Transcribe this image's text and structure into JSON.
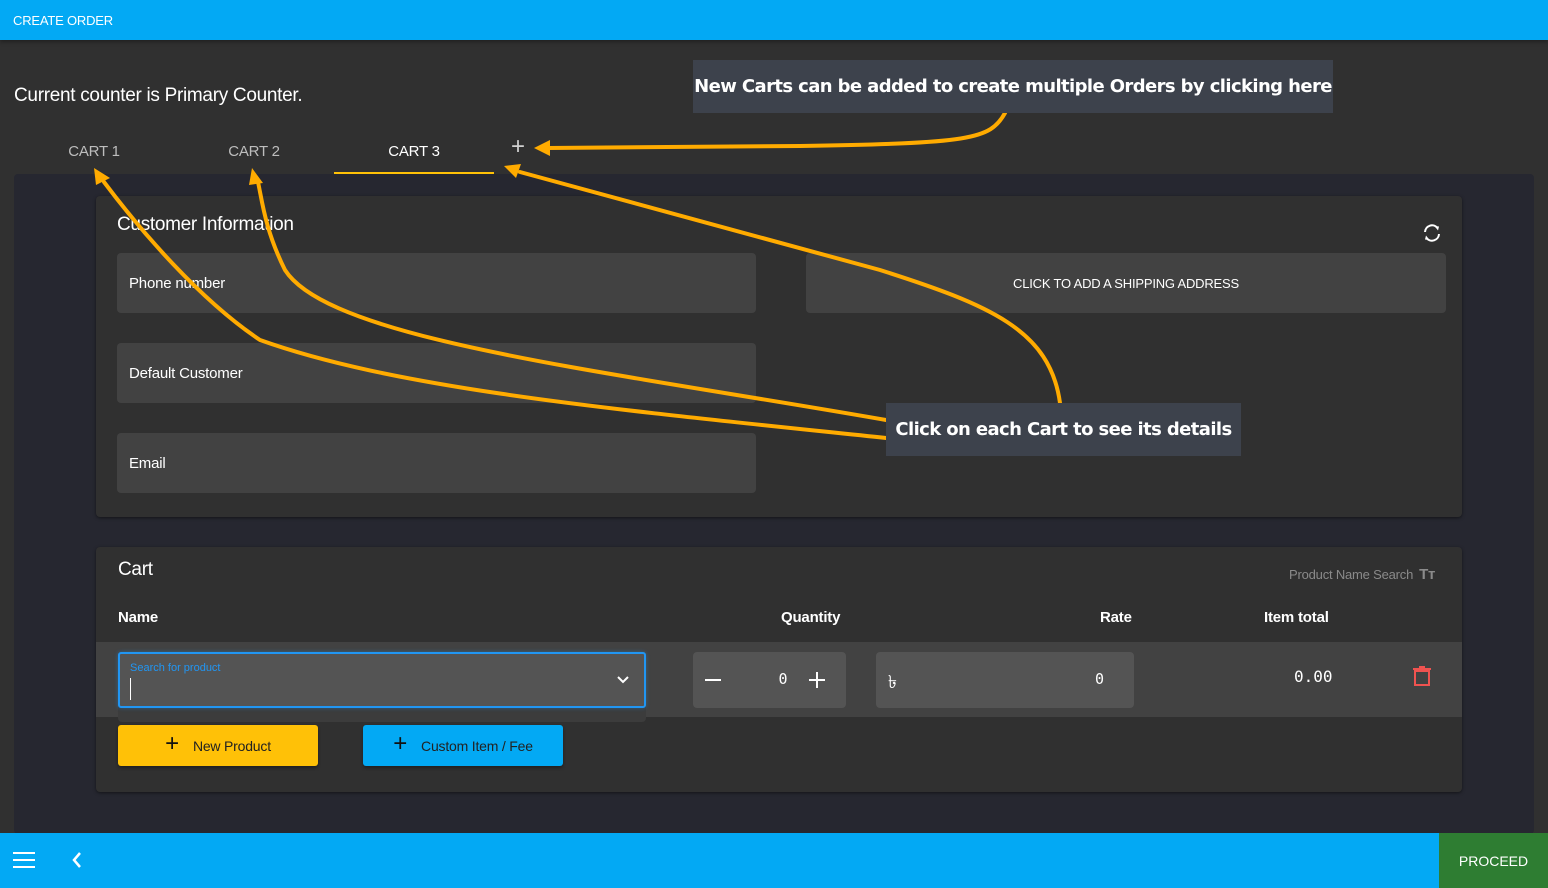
{
  "header": {
    "title": "CREATE ORDER"
  },
  "counter_text": "Current counter is Primary Counter.",
  "tabs": [
    {
      "label": "CART 1",
      "active": false
    },
    {
      "label": "CART 2",
      "active": false
    },
    {
      "label": "CART 3",
      "active": true
    }
  ],
  "add_tab_icon": "plus-icon",
  "customer_info": {
    "title": "Customer Information",
    "refresh_icon": "refresh-icon",
    "phone_placeholder": "Phone number",
    "name_value": "Default Customer",
    "email_placeholder": "Email",
    "shipping_button": "CLICK TO ADD A SHIPPING ADDRESS"
  },
  "cart": {
    "title": "Cart",
    "product_name_search": "Product Name Search",
    "product_name_search_icon": "Tт",
    "columns": {
      "name": "Name",
      "quantity": "Quantity",
      "rate": "Rate",
      "item_total": "Item total"
    },
    "row": {
      "search_label": "Search for product",
      "search_value": "",
      "quantity": "0",
      "currency_symbol": "৳",
      "rate": "0",
      "item_total": "0.00"
    },
    "buttons": {
      "new_product": "New Product",
      "custom_item": "Custom Item / Fee"
    }
  },
  "footer": {
    "proceed": "PROCEED"
  },
  "annotations": {
    "callout_new_cart": "New Carts can be added to create multiple Orders by clicking here",
    "callout_click_cart": "Click on each Cart to see its details"
  },
  "colors": {
    "primary": "#03a9f4",
    "accent": "#ffc107",
    "proceed": "#2e7d32",
    "delete": "#ef5350",
    "annotation_arrow": "#ffab00"
  }
}
